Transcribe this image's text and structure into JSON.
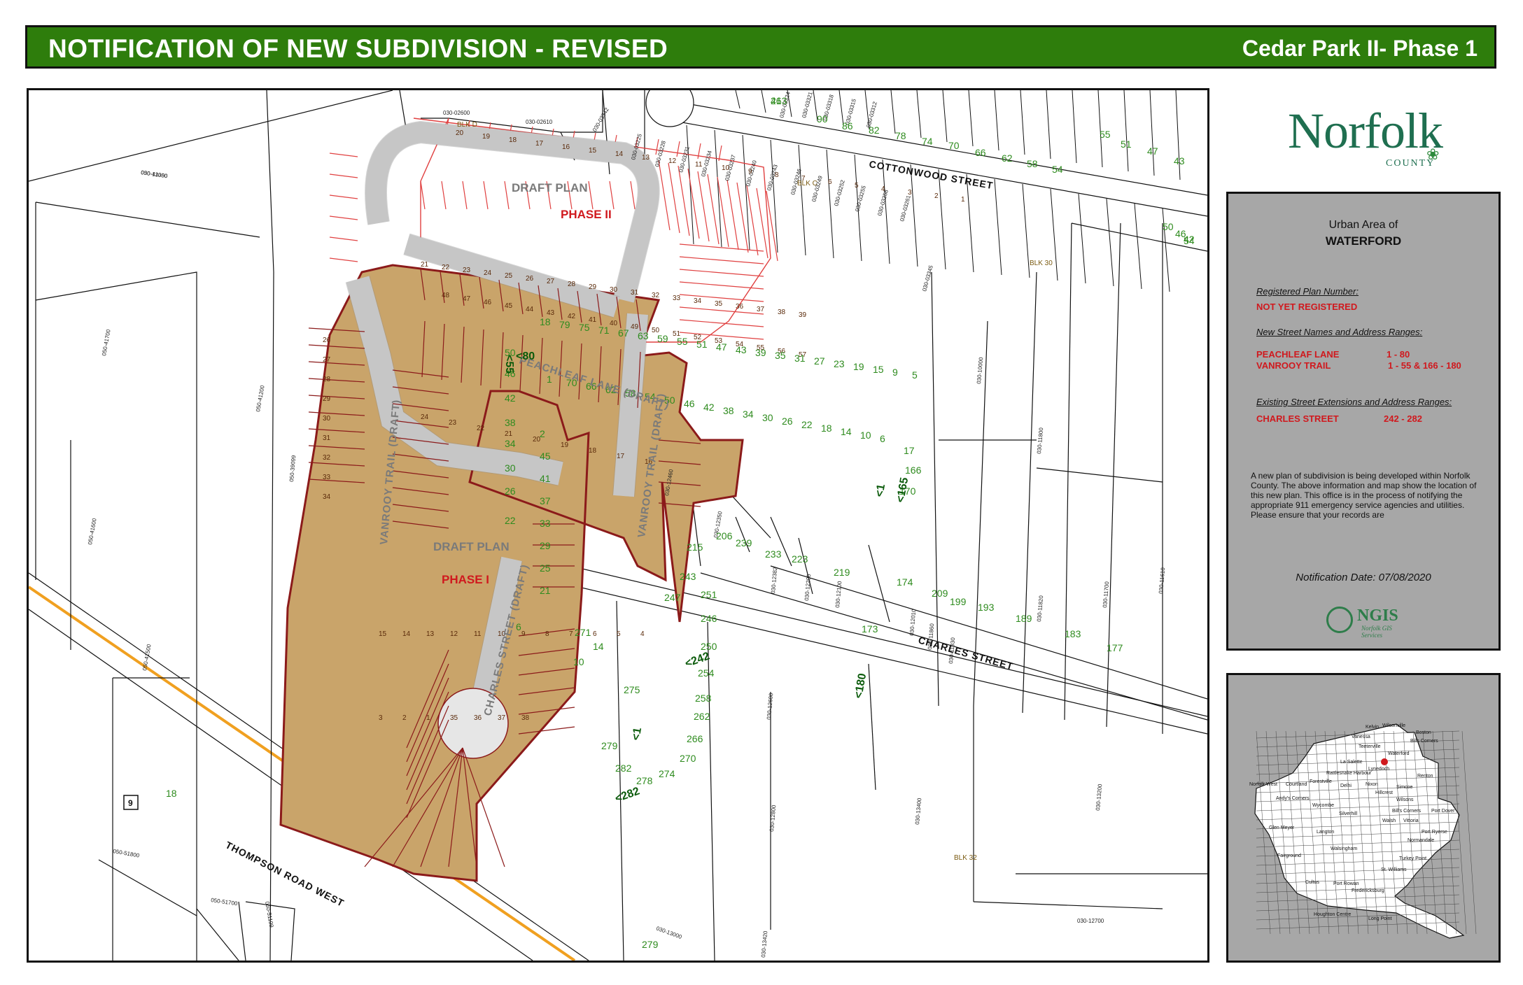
{
  "banner": {
    "title": "NOTIFICATION OF NEW SUBDIVISION - REVISED",
    "subdivision_name": "Cedar Park II- Phase 1",
    "color": "#2e7d0c"
  },
  "logo": {
    "wordmark": "Norfolk",
    "sub": "COUNTY",
    "icon": "maple-leaf-icon"
  },
  "info": {
    "urban_area_label": "Urban Area of",
    "urban_area_name": "WATERFORD",
    "registered_plan_label": "Registered Plan Number:",
    "registered_plan_value": "NOT YET REGISTERED",
    "new_streets_label": "New Street Names and Address Ranges:",
    "new_streets": [
      {
        "name": "PEACHLEAF LANE",
        "range": "1 - 80"
      },
      {
        "name": "VANROOY TRAIL",
        "range": "1 - 55 & 166 - 180"
      }
    ],
    "existing_streets_label": "Existing Street Extensions and Address Ranges:",
    "existing_streets": [
      {
        "name": "CHARLES STREET",
        "range": "242 - 282"
      }
    ],
    "notice_text": "A new plan of subdivision is being developed within Norfolk County.  The above information and map show the location of this new plan.   This office is in the process of notifying the appropriate 911 emergency service agencies and utilities.   Please ensure that your records are",
    "notification_date": "Notification Date: 07/08/2020",
    "accent_red": "#d0191e",
    "box_gray": "#a7a7a7"
  },
  "ngis": {
    "name": "NGIS",
    "sub1": "Norfolk GIS",
    "sub2": "Services"
  },
  "map": {
    "parcel_fill": "#c9a46a",
    "parcel_outline": "#8b1a1a",
    "phase2_lines": "#e04040",
    "address_color": "#2e8b1e",
    "streets": [
      {
        "label": "COTTONWOOD STREET"
      },
      {
        "label": "CHARLES STREET"
      },
      {
        "label": "THOMPSON ROAD WEST"
      },
      {
        "label": "PEACHLEAF LANE (DRAFT)"
      },
      {
        "label": "VANROOY TRAIL (DRAFT)"
      },
      {
        "label": "VANROOY TRAIL (DRAFT)"
      },
      {
        "label": "CHARLES STREET (DRAFT)"
      }
    ],
    "highway_shield": "9",
    "plan_labels": [
      {
        "text": "DRAFT PLAN"
      },
      {
        "text": "PHASE II"
      },
      {
        "text": "DRAFT PLAN"
      },
      {
        "text": "PHASE I"
      }
    ],
    "block_labels": [
      "BLK D",
      "BLK C",
      "BLK 30",
      "BLK 32"
    ],
    "range_markers": [
      "<55",
      "<80",
      "<1",
      "<165",
      "<180",
      "<242",
      "<1",
      "<282"
    ],
    "roll_numbers": [
      "050-41000",
      "050-41700",
      "050-41200",
      "050-41600",
      "050-41500",
      "050-51800",
      "050-51700",
      "050-51199",
      "050-39099",
      "030-02600",
      "030-02610",
      "030-03342",
      "030-03225",
      "030-03228",
      "030-03231",
      "030-03234",
      "030-03237",
      "030-03240",
      "030-03243",
      "030-03246",
      "030-03249",
      "030-03252",
      "030-03255",
      "030-03258",
      "030-03261",
      "030-03345",
      "030-03324",
      "030-03321",
      "030-03318",
      "030-03315",
      "030-03312",
      "030-10000",
      "030-11800",
      "030-11700",
      "030-11610",
      "030-11820",
      "030-11930",
      "030-11860",
      "030-12010",
      "030-12100",
      "030-12200",
      "030-12382",
      "030-12350",
      "030-12460",
      "030-12600",
      "030-12800",
      "030-13400",
      "030-13200",
      "030-12700",
      "030-13000",
      "030-13420",
      "030-13350"
    ],
    "address_numbers": [
      "46",
      "90",
      "86",
      "82",
      "78",
      "74",
      "70",
      "66",
      "62",
      "58",
      "54",
      "55",
      "51",
      "47",
      "43",
      "50",
      "46",
      "42",
      "54",
      "50",
      "46",
      "42",
      "38",
      "34",
      "30",
      "26",
      "22",
      "18",
      "79",
      "75",
      "71",
      "67",
      "63",
      "59",
      "55",
      "51",
      "47",
      "43",
      "39",
      "35",
      "31",
      "27",
      "23",
      "19",
      "15",
      "9",
      "5",
      "1",
      "70",
      "66",
      "62",
      "58",
      "54",
      "50",
      "46",
      "42",
      "38",
      "34",
      "30",
      "26",
      "22",
      "18",
      "14",
      "10",
      "6",
      "2",
      "45",
      "41",
      "37",
      "33",
      "29",
      "25",
      "21",
      "17",
      "166",
      "170",
      "174",
      "209",
      "199",
      "193",
      "189",
      "183",
      "177",
      "173",
      "206",
      "239",
      "233",
      "223",
      "219",
      "215",
      "243",
      "247",
      "251",
      "246",
      "250",
      "254",
      "258",
      "262",
      "266",
      "270",
      "274",
      "278",
      "282",
      "279",
      "275",
      "271",
      "14",
      "10",
      "6",
      "18",
      "279",
      "213"
    ],
    "lot_numbers": [
      "20",
      "19",
      "18",
      "17",
      "16",
      "15",
      "14",
      "13",
      "12",
      "11",
      "10",
      "9",
      "8",
      "7",
      "6",
      "5",
      "4",
      "3",
      "2",
      "1",
      "21",
      "22",
      "23",
      "24",
      "25",
      "26",
      "27",
      "28",
      "29",
      "30",
      "31",
      "32",
      "33",
      "34",
      "35",
      "36",
      "37",
      "38",
      "39",
      "48",
      "47",
      "46",
      "45",
      "44",
      "43",
      "42",
      "41",
      "40",
      "49",
      "50",
      "51",
      "52",
      "53",
      "54",
      "55",
      "56",
      "57",
      "26",
      "27",
      "28",
      "29",
      "30",
      "31",
      "32",
      "33",
      "34",
      "24",
      "23",
      "22",
      "21",
      "20",
      "19",
      "18",
      "17",
      "16",
      "15",
      "14",
      "13",
      "12",
      "11",
      "10",
      "9",
      "8",
      "7",
      "6",
      "5",
      "4",
      "3",
      "2",
      "1",
      "35",
      "36",
      "37",
      "38"
    ]
  },
  "keymap": {
    "places": [
      "Kelvin",
      "Wilsonville",
      "Boston",
      "Vanessa",
      "Bills Corners",
      "Teeterville",
      "Waterford",
      "La Salette",
      "Lynedoch",
      "Rattlesnake Harbour",
      "Renton",
      "Norfolk West",
      "Courtland",
      "Forestville",
      "Delhi",
      "Nixon",
      "Simcoe",
      "Andy's Corners",
      "Wycombe",
      "Hillcrest",
      "Wilsons",
      "Silverhill",
      "Bill's Corners",
      "Port Dover",
      "Glen Meyer",
      "Langton",
      "Walsh",
      "Vittoria",
      "Port Ryerse",
      "Normandale",
      "Walsingham",
      "Fairground",
      "Turkey Point",
      "St. Williams",
      "Port Rowan",
      "Cultus",
      "Long Point",
      "Houghton Centre",
      "Fredericksburg"
    ]
  }
}
